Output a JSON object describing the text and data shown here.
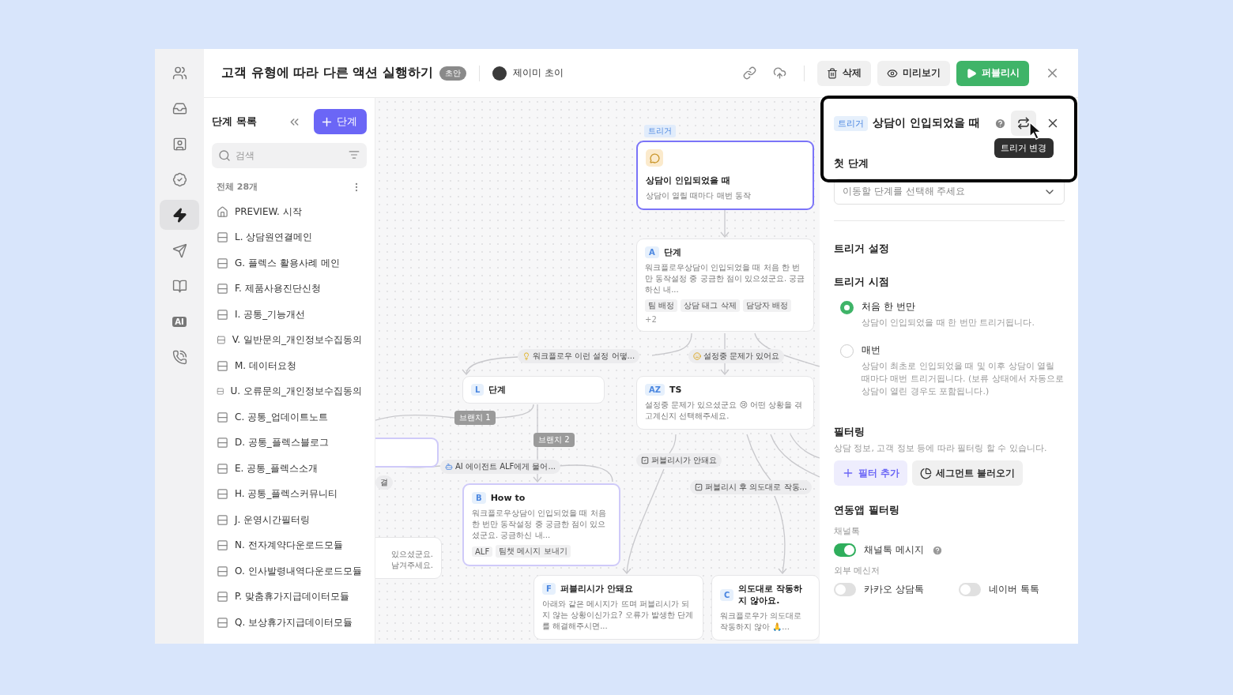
{
  "rail": [
    {
      "kind": "icon",
      "selected": false
    },
    {
      "kind": "icon",
      "selected": false
    },
    {
      "kind": "icon",
      "selected": false
    },
    {
      "kind": "icon",
      "selected": false
    },
    {
      "kind": "icon",
      "selected": true
    },
    {
      "kind": "icon",
      "selected": false
    },
    {
      "kind": "icon",
      "selected": false
    },
    {
      "kind": "badge",
      "label": "AI",
      "selected": false
    },
    {
      "kind": "icon",
      "selected": false
    }
  ],
  "header": {
    "title": "고객 유형에 따라 다른 액션 실행하기",
    "status_badge": "초안",
    "author": "제이미 초이",
    "buttons": [
      {
        "kind": "delete",
        "label": "삭제"
      },
      {
        "kind": "preview",
        "label": "미리보기"
      },
      {
        "kind": "publish",
        "label": "퍼블리시"
      }
    ]
  },
  "step_list": {
    "title": "단계 목록",
    "add_button": "단계",
    "search": {
      "placeholder": "검색"
    },
    "count": "전체 28개",
    "items": [
      {
        "kind": "home",
        "label": "PREVIEW. 시작"
      },
      {
        "kind": "step",
        "label": "L. 상담원연결메인"
      },
      {
        "kind": "step",
        "label": "G. 플렉스 활용사례 메인"
      },
      {
        "kind": "step",
        "label": "F. 제품사용진단신청"
      },
      {
        "kind": "step",
        "label": "I. 공통_기능개선"
      },
      {
        "kind": "step",
        "label": "V. 일반문의_개인정보수집동의"
      },
      {
        "kind": "step",
        "label": "M. 데이터요청"
      },
      {
        "kind": "step",
        "label": "U. 오류문의_개인정보수집동의"
      },
      {
        "kind": "step",
        "label": "C. 공통_업데이트노트"
      },
      {
        "kind": "step",
        "label": "D. 공통_플렉스블로그"
      },
      {
        "kind": "step",
        "label": "E. 공통_플렉스소개"
      },
      {
        "kind": "step",
        "label": "H. 공통_플렉스커뮤니티"
      },
      {
        "kind": "step",
        "label": "J. 운영시간필터링"
      },
      {
        "kind": "step",
        "label": "N. 전자계약다운로드모듈"
      },
      {
        "kind": "step",
        "label": "O. 인사발령내역다운로드모듈"
      },
      {
        "kind": "step",
        "label": "P. 맞춤휴가지급데이터모듈"
      },
      {
        "kind": "step",
        "label": "Q. 보상휴가지급데이터모듈"
      }
    ]
  },
  "canvas": {
    "trigger": {
      "tag": "트리거",
      "title": "상담이 인입되었을 때",
      "description": "상담이 열릴 때마다 매번 동작",
      "selected": true
    },
    "nodes": [
      {
        "badge": "A",
        "title": "단계",
        "description": "워크플로우상담이 인입되었을 때 처음 한 번만 동작설정 중 궁금한 점이 있으셨군요. 궁금하신 내...",
        "tags": [
          "팀 배정",
          "상담 태그 삭제",
          "담당자 배정"
        ],
        "more": "+2",
        "highlighted": false
      },
      {
        "badge": "L",
        "title": "단계",
        "highlighted": false
      },
      {
        "badge": "AZ",
        "title": "TS",
        "description": "설정중 문제가 있으셨군요 😢 어떤 상황을 겪고계신지 선택해주세요.",
        "highlighted": false
      },
      {
        "highlighted": true
      },
      {
        "badge": "B",
        "title": "How to",
        "description": "워크플로우상담이 인입되었을 때 처음 한 번만 동작설정 중 궁금한 점이 있으셨군요. 궁금하신 내...",
        "tags": [
          "ALF",
          "팀챗 메시지 보내기"
        ],
        "highlighted": true
      },
      {
        "lines": [
          "있으셨군요.",
          "남겨주세요."
        ],
        "highlighted": false
      },
      {
        "badge": "F",
        "title": "퍼블리시가 안돼요",
        "description": "아래와 같은 메시지가 뜨며 퍼블리시가 되지 않는 상황이신가요? 오류가 발생한 단계를 해결해주시면...",
        "highlighted": false
      },
      {
        "badge": "C",
        "title": "의도대로 작동하지 않아요.",
        "description": "워크플로우가 의도대로 작동하지 않아 🙏...",
        "highlighted": false
      }
    ],
    "edge_labels": [
      {
        "kind": "bulb",
        "text": "워크플로우 이런 설정 어떻..."
      },
      {
        "kind": "thinking",
        "text": "설정중 문제가 있어요"
      },
      {
        "kind": "branch",
        "text": "브랜치 1"
      },
      {
        "kind": "branch",
        "text": "브랜치 2"
      },
      {
        "kind": "robot",
        "text": "AI 에이전트 ALF에게 물어..."
      },
      {
        "kind": "plain",
        "text": "결"
      },
      {
        "kind": "check",
        "text": "퍼블리시가 안돼요"
      },
      {
        "kind": "check",
        "text": "퍼블리시 후 의도대로 작동..."
      }
    ]
  },
  "panel": {
    "tag": "트리거",
    "title": "상담이 인입되었을 때",
    "tooltip": "트리거 변경",
    "first_step": {
      "label": "첫 단계",
      "placeholder": "이동할 단계를 선택해 주세요"
    },
    "settings_title": "트리거 설정",
    "timing_title": "트리거 시점",
    "timing_options": [
      {
        "label": "처음 한 번만",
        "description": "상담이 인입되었을 때 한 번만 트리거됩니다.",
        "selected": true
      },
      {
        "label": "매번",
        "description": "상담이 최초로 인입되었을 때 및 이후  상담이 열릴 때마다 매번 트리거됩니다. (보류 상태에서 자동으로 상담이 열린 경우도 포함됩니다.)",
        "selected": false
      }
    ],
    "filtering": {
      "title": "필터링",
      "description": "상담 정보, 고객 정보 등에 따라 필터링 할 수 있습니다.",
      "add_button": "필터 추가",
      "segment_button": "세그먼트 불러오기"
    },
    "app_filtering": {
      "title": "연동앱 필터링",
      "groups": [
        {
          "label": "채널톡",
          "toggles": [
            {
              "label": "채널톡 메시지",
              "on": true,
              "help": true
            }
          ]
        },
        {
          "label": "외부 메신저",
          "toggles": [
            {
              "label": "카카오 상담톡",
              "on": false,
              "help": false
            },
            {
              "label": "네이버 톡톡",
              "on": false,
              "help": false
            }
          ]
        }
      ]
    }
  }
}
